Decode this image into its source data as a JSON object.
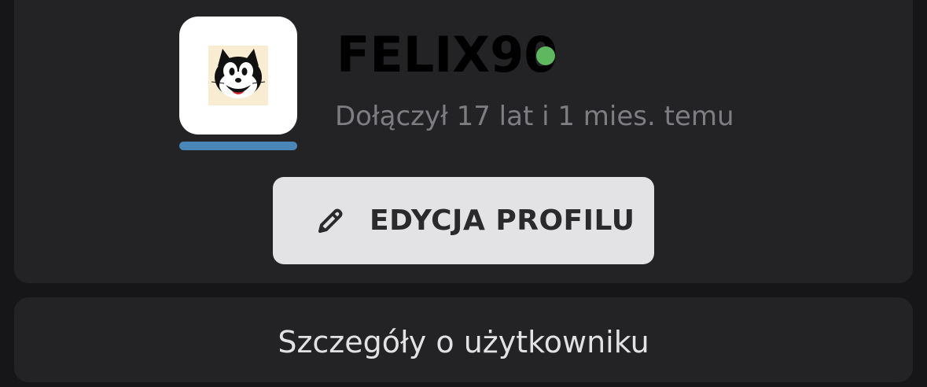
{
  "profile": {
    "username": "FELIX90",
    "online": true,
    "joined_text": "Dołączył 17 lat i 1 mies. temu",
    "avatar_description_icon": "felix-cat-avatar",
    "edit_button_label": "EDYCJA PROFILU",
    "edit_icon": "pencil-icon"
  },
  "details": {
    "label": "Szczegóły o użytkowniku"
  },
  "colors": {
    "background": "#161618",
    "card": "#232326",
    "online_dot": "#5fb760",
    "avatar_bar": "#4a86b8",
    "button_bg": "#e3e3e6"
  }
}
